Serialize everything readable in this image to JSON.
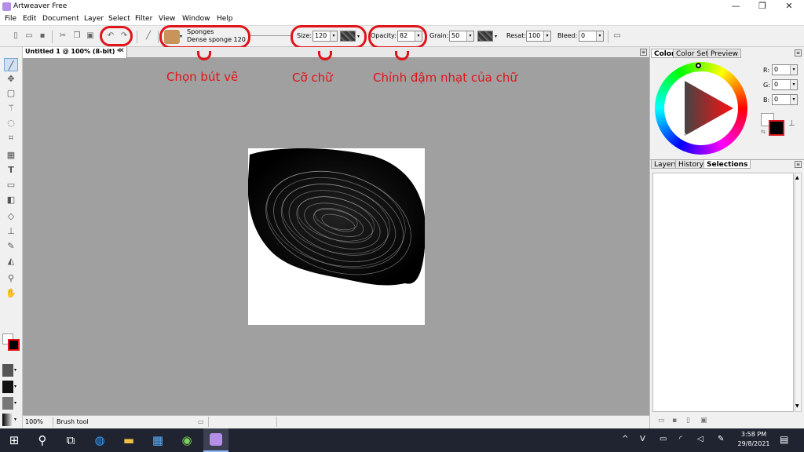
{
  "window": {
    "title": "Artweaver Free",
    "minimize": "—",
    "maximize": "❐",
    "close": "✕"
  },
  "menu": [
    "File",
    "Edit",
    "Document",
    "Layer",
    "Select",
    "Filter",
    "View",
    "Window",
    "Help"
  ],
  "toolbar": {
    "brush_category": "Sponges",
    "brush_variant": "Dense sponge 120",
    "size_label": "Size:",
    "size_value": "120",
    "opacity_label": "Opacity:",
    "opacity_value": "82",
    "grain_label": "Grain:",
    "grain_value": "50",
    "resat_label": "Resat:",
    "resat_value": "100",
    "bleed_label": "Bleed:",
    "bleed_value": "0"
  },
  "annotations": {
    "brush": "Chọn bút vẽ",
    "size": "Cỡ chữ",
    "opacity": "Chỉnh đậm nhạt của chữ"
  },
  "document": {
    "tab_title": "Untitled 1 @ 100% (8-bit) *",
    "close": "✕"
  },
  "status": {
    "zoom": "100%",
    "tool": "Brush tool"
  },
  "color_panel": {
    "tabs": [
      "Color",
      "Color Set",
      "Preview"
    ],
    "r_label": "R:",
    "r_value": "0",
    "g_label": "G:",
    "g_value": "0",
    "b_label": "B:",
    "b_value": "0",
    "foreground": "#000000",
    "background": "#ffffff",
    "accent": "#e0141a"
  },
  "layers_panel": {
    "tabs": [
      "Layers",
      "History",
      "Selections"
    ]
  },
  "taskbar": {
    "time": "3:58 PM",
    "date": "29/8/2021"
  }
}
